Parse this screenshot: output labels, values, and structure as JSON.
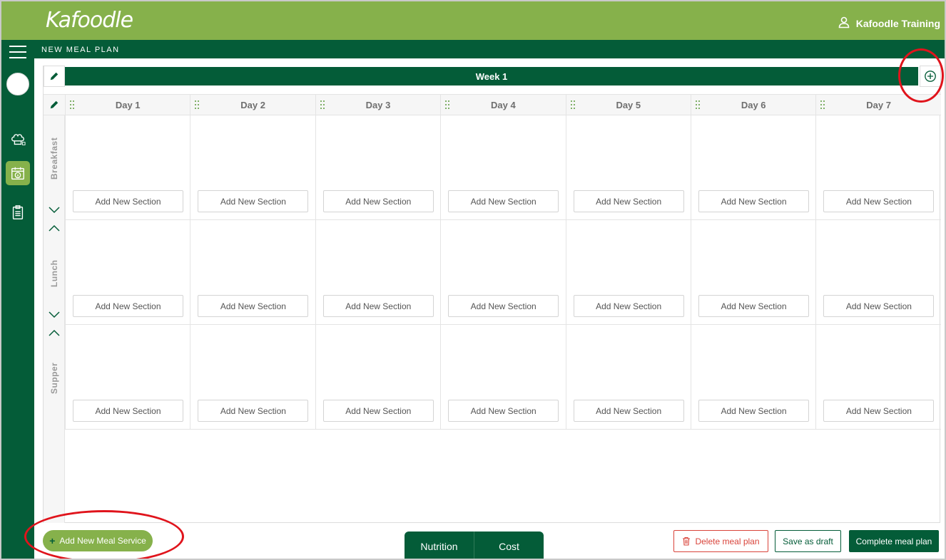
{
  "app": {
    "logo_text": "Kafoodle",
    "user_name": "Kafoodle Training",
    "page_title": "NEW MEAL PLAN"
  },
  "sidebar": {
    "items": [
      {
        "icon": "menu-icon"
      },
      {
        "icon": "avatar"
      },
      {
        "icon": "chef-hat-icon"
      },
      {
        "icon": "calendar-info-icon",
        "active": true
      },
      {
        "icon": "clipboard-icon"
      }
    ]
  },
  "week": {
    "label": "Week 1"
  },
  "days": [
    "Day 1",
    "Day 2",
    "Day 3",
    "Day 4",
    "Day 5",
    "Day 6",
    "Day 7"
  ],
  "meals": [
    {
      "label": "Breakfast",
      "add_section_label": "Add New Section"
    },
    {
      "label": "Lunch",
      "add_section_label": "Add New Section"
    },
    {
      "label": "Supper",
      "add_section_label": "Add New Section"
    }
  ],
  "footer": {
    "add_meal_service": "Add New Meal Service",
    "tabs": [
      "Nutrition",
      "Cost"
    ],
    "delete_label": "Delete meal plan",
    "draft_label": "Save as draft",
    "complete_label": "Complete meal plan"
  },
  "colors": {
    "brand_light": "#86b14b",
    "brand_dark": "#045c38",
    "danger": "#d9433a",
    "annotation": "#e0141c"
  }
}
